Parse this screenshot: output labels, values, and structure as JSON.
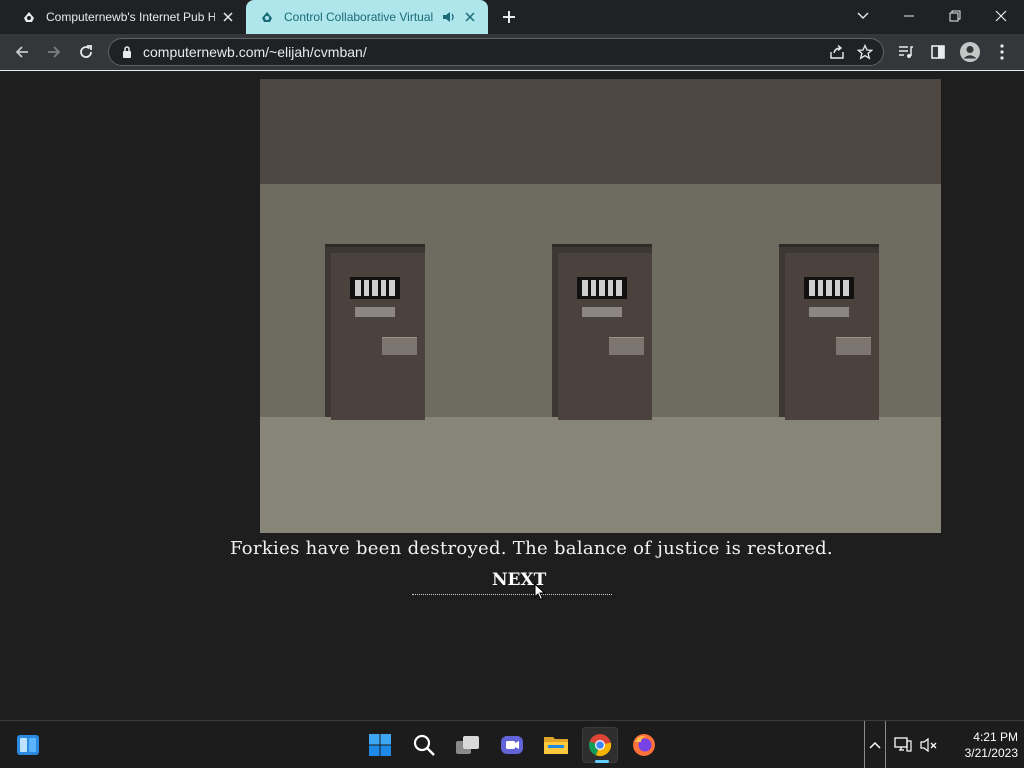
{
  "browser": {
    "tabs": [
      {
        "title": "Computernewb's Internet Pub H",
        "favicon": "computernewb-favicon",
        "active": false
      },
      {
        "title": "Control Collaborative Virtual",
        "favicon": "computernewb-favicon",
        "active": true,
        "audio": true
      }
    ],
    "address": "computernewb.com/~elijah/cvmban/"
  },
  "page": {
    "message": "Forkies have been destroyed. The balance of justice is restored.",
    "next_label": "NEXT"
  },
  "scene": {
    "doors": 3,
    "colors": {
      "ceiling": "#4d4641",
      "wall": "#6e6b61",
      "floor": "#878577",
      "door": "#4b423d"
    }
  },
  "taskbar": {
    "apps": [
      "widgets",
      "start",
      "search",
      "task-view",
      "chat",
      "file-explorer",
      "chrome",
      "firefox"
    ],
    "clock": {
      "time": "4:21 PM",
      "date": "3/21/2023"
    }
  },
  "colors": {
    "accent": "#60cdff",
    "active_tab": "#aee6ec",
    "active_tab_text": "#1a6b77"
  }
}
